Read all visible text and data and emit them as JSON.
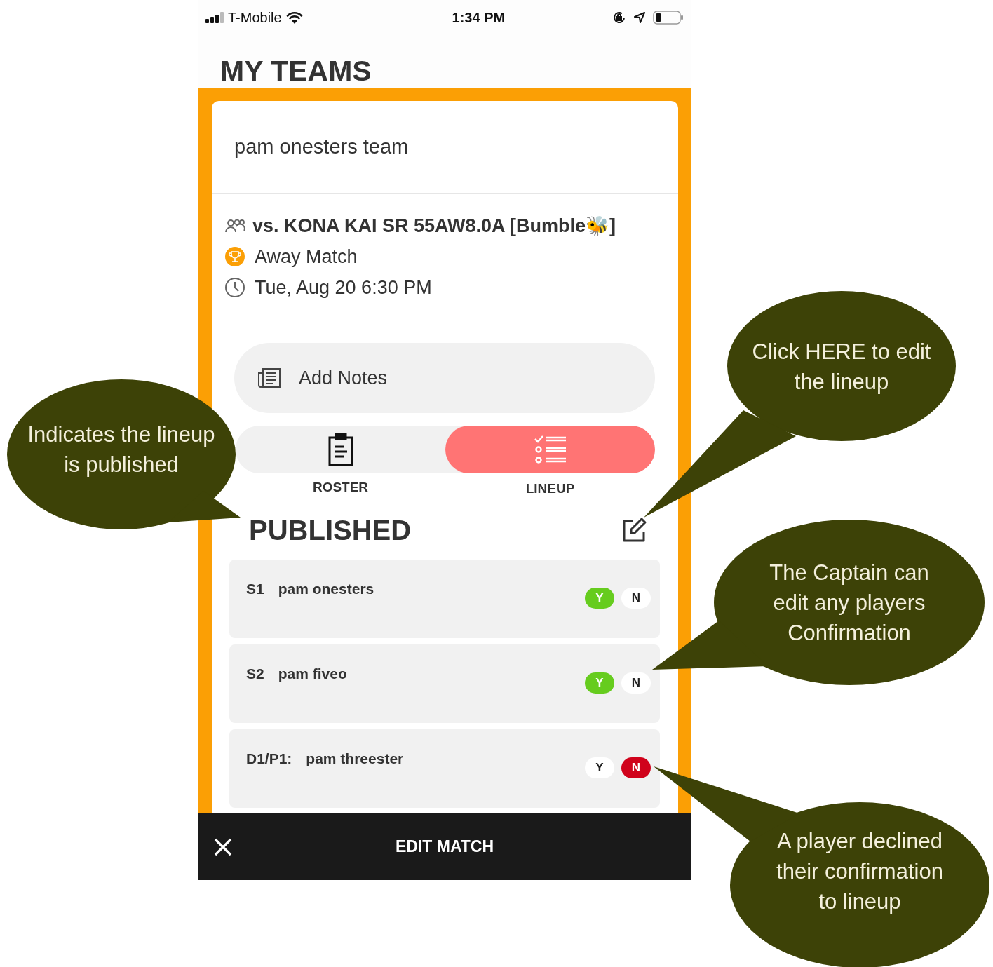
{
  "status_bar": {
    "carrier": "T-Mobile",
    "time": "1:34 PM"
  },
  "page_title": "MY TEAMS",
  "team": {
    "name": "pam onesters team"
  },
  "match": {
    "opponent": "vs. KONA KAI SR 55AW8.0A [Bumble🐝]",
    "type": "Away Match",
    "datetime": "Tue, Aug 20 6:30 PM"
  },
  "notes_button": {
    "label": "Add Notes"
  },
  "tabs": [
    {
      "label": "ROSTER",
      "kind": "roster",
      "selected": false
    },
    {
      "label": "LINEUP",
      "kind": "lineup",
      "selected": true
    }
  ],
  "lineup_status": "PUBLISHED",
  "lineup": [
    {
      "slot": "S1",
      "player": "pam onesters",
      "yes": {
        "label": "Y",
        "selected": true
      },
      "no": {
        "label": "N",
        "selected": false
      }
    },
    {
      "slot": "S2",
      "player": "pam fiveo",
      "yes": {
        "label": "Y",
        "selected": true
      },
      "no": {
        "label": "N",
        "selected": false
      }
    },
    {
      "slot": "D1/P1:",
      "player": "pam threester",
      "yes": {
        "label": "Y",
        "selected": false
      },
      "no": {
        "label": "N",
        "selected": true
      }
    }
  ],
  "bottom_bar": {
    "title": "EDIT MATCH"
  },
  "callouts": [
    {
      "kind": "left",
      "text": "Indicates the lineup is published"
    },
    {
      "kind": "top-right",
      "text": "Click HERE to edit the lineup"
    },
    {
      "kind": "mid-right",
      "text": "The Captain can edit any players Confirmation"
    },
    {
      "kind": "bottom-right",
      "text": "A player declined their confirmation to lineup"
    }
  ]
}
